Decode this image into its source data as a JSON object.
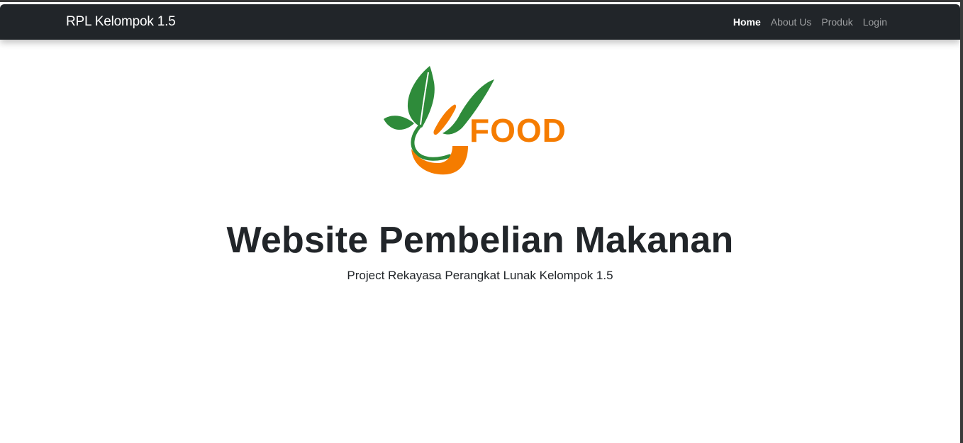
{
  "navbar": {
    "brand": "RPL Kelompok 1.5",
    "links": [
      {
        "label": "Home",
        "active": true
      },
      {
        "label": "About Us",
        "active": false
      },
      {
        "label": "Produk",
        "active": false
      },
      {
        "label": "Login",
        "active": false
      }
    ]
  },
  "logo": {
    "wordmark": "FOOD",
    "colors": {
      "green": "#2e8b3a",
      "orange": "#f57c00"
    }
  },
  "hero": {
    "title": "Website Pembelian Makanan",
    "subtitle": "Project Rekayasa Perangkat Lunak Kelompok 1.5"
  },
  "theme": {
    "navbar_bg": "#212529",
    "text_dark": "#212529"
  }
}
